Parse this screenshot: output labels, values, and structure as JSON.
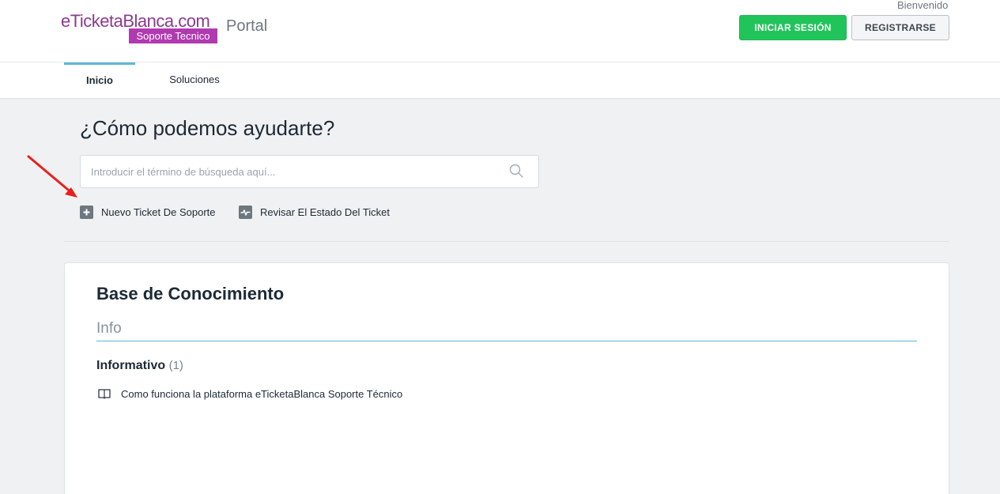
{
  "header": {
    "logo_main": "eTicketaBlanca.com",
    "logo_sub": "Soporte Tecnico",
    "portal_title": "Portal",
    "welcome_text": "Bienvenido",
    "login_label": "INICIAR SESIÓN",
    "register_label": "REGISTRARSE"
  },
  "nav": {
    "tabs": [
      {
        "label": "Inicio",
        "active": true
      },
      {
        "label": "Soluciones",
        "active": false
      }
    ]
  },
  "hero": {
    "title": "¿Cómo podemos ayudarte?",
    "search_placeholder": "Introducir el término de búsqueda aquí...",
    "search_value": "",
    "quick_links": [
      {
        "label": "Nuevo Ticket De Soporte",
        "icon": "plus-icon"
      },
      {
        "label": "Revisar El Estado Del Ticket",
        "icon": "activity-icon"
      }
    ]
  },
  "knowledge_base": {
    "title": "Base de Conocimiento",
    "section": "Info",
    "categories": [
      {
        "name": "Informativo",
        "count": "(1)",
        "articles": [
          {
            "title": "Como funciona la plataforma eTicketaBlanca Soporte Técnico",
            "icon": "book-icon"
          }
        ]
      }
    ]
  },
  "colors": {
    "accent": "#5bb7d9",
    "login_green": "#21c45a",
    "logo_purple": "#b03ab0",
    "annotation_arrow": "#e8201c"
  }
}
